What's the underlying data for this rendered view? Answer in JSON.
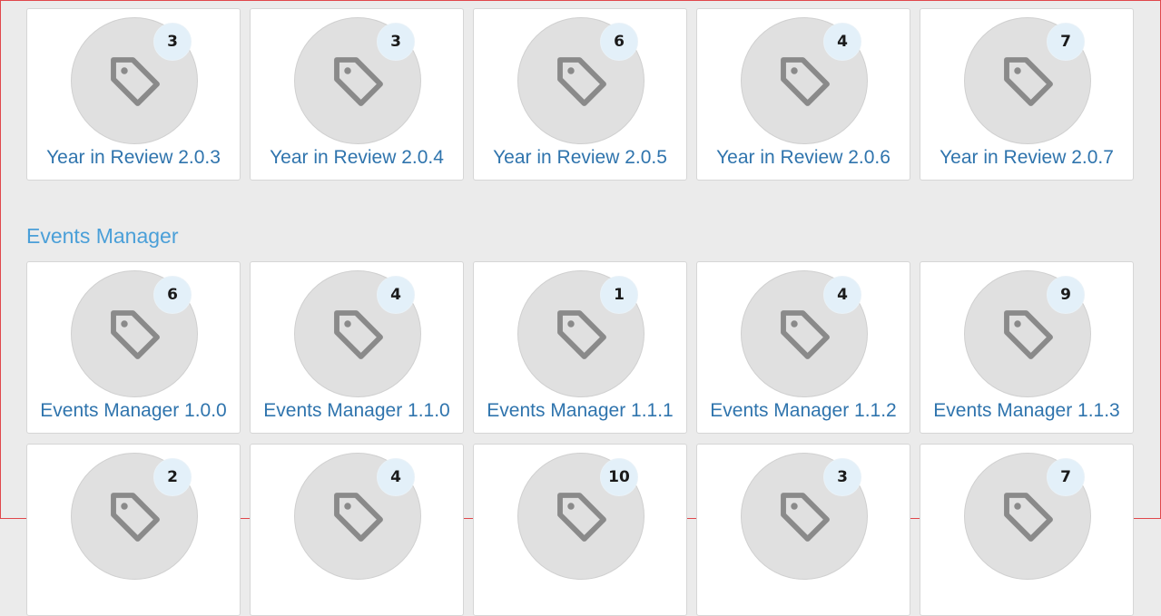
{
  "colors": {
    "accent": "#4a9fd8",
    "link": "#2f74ad",
    "badge_bg": "#e3f0f9",
    "icon_bg": "#e0e0e0"
  },
  "year_in_review": {
    "cards": [
      {
        "label": "Year in Review 2.0.3",
        "count": "3"
      },
      {
        "label": "Year in Review 2.0.4",
        "count": "3"
      },
      {
        "label": "Year in Review 2.0.5",
        "count": "6"
      },
      {
        "label": "Year in Review 2.0.6",
        "count": "4"
      },
      {
        "label": "Year in Review 2.0.7",
        "count": "7"
      }
    ]
  },
  "events_manager": {
    "title": "Events Manager",
    "cards": [
      {
        "label": "Events Manager 1.0.0",
        "count": "6"
      },
      {
        "label": "Events Manager 1.1.0",
        "count": "4"
      },
      {
        "label": "Events Manager 1.1.1",
        "count": "1"
      },
      {
        "label": "Events Manager 1.1.2",
        "count": "4"
      },
      {
        "label": "Events Manager 1.1.3",
        "count": "9"
      }
    ],
    "cards_row2": [
      {
        "count": "2"
      },
      {
        "count": "4"
      },
      {
        "count": "10"
      },
      {
        "count": "3"
      },
      {
        "count": "7"
      }
    ]
  },
  "icon": "tag-icon"
}
